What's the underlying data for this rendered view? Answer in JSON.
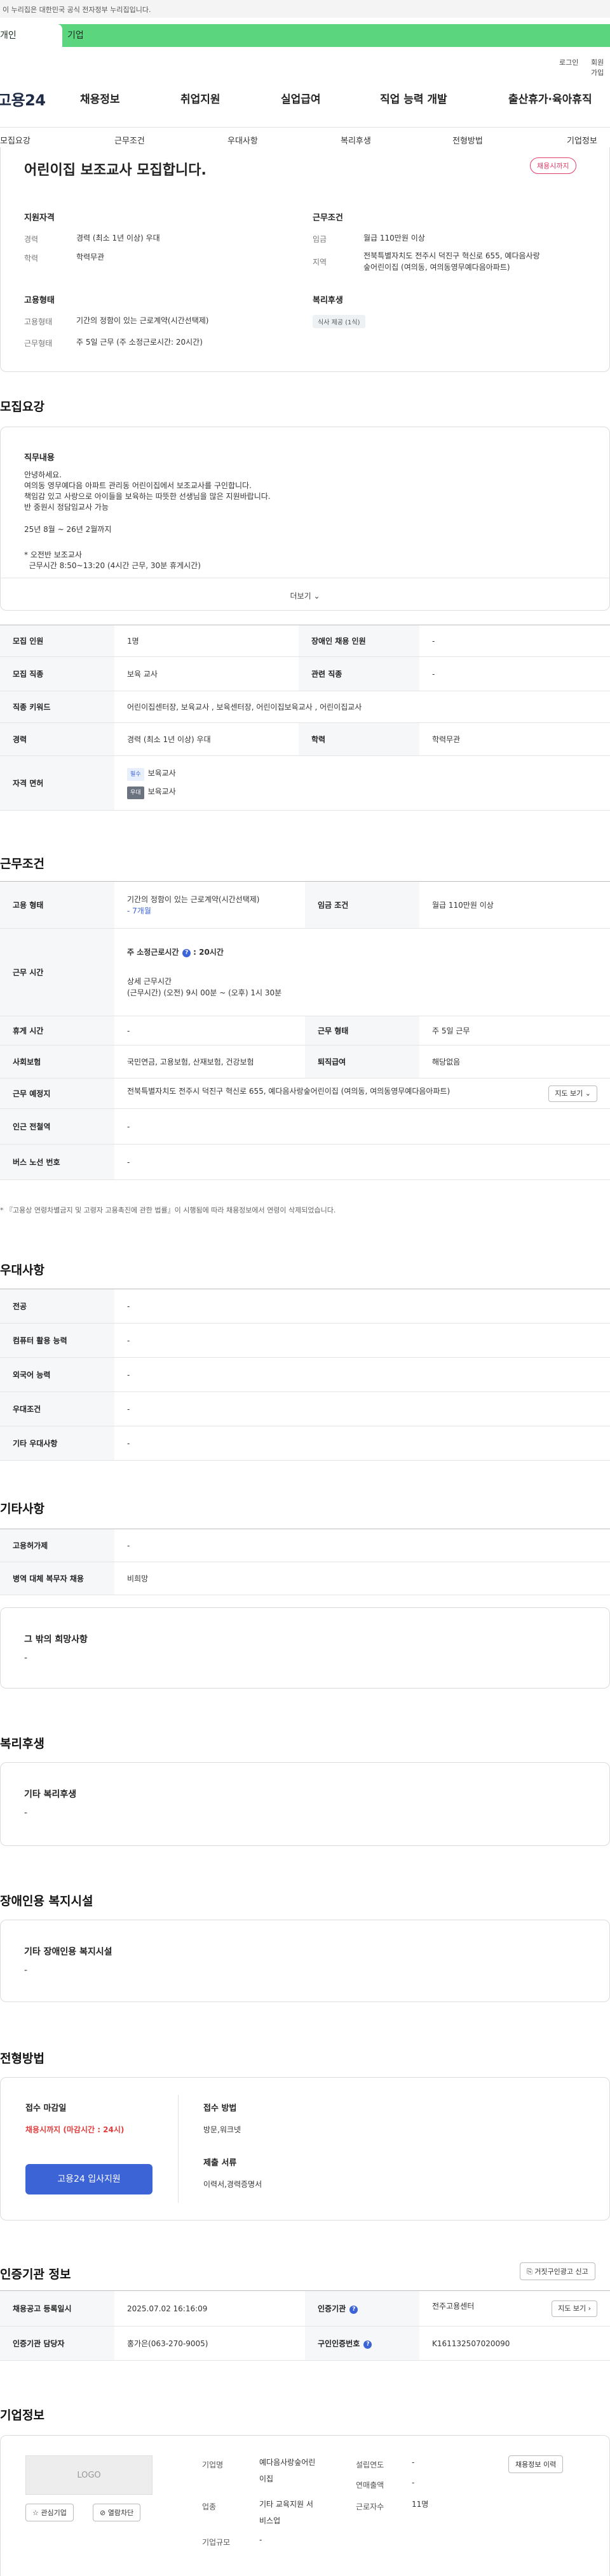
{
  "gov_banner": "이 누리집은 대한민국 공식 전자정부 누리집입니다.",
  "top_tabs": {
    "personal": "개인",
    "company": "기업"
  },
  "utility": {
    "login": "로그인",
    "signup": "회원가입"
  },
  "logo": "고용24",
  "gnb": [
    "채용정보",
    "취업지원",
    "실업급여",
    "직업 능력 개발",
    "출산휴가·육아휴직"
  ],
  "lnb": [
    "모집요강",
    "근무조건",
    "우대사항",
    "복리후생",
    "전형방법",
    "기업정보"
  ],
  "headline": {
    "title": "어린이집 보조교사 모집합니다.",
    "badge": "채용시까지"
  },
  "summary": {
    "qual_heading": "지원자격",
    "career_label": "경력",
    "career_value": "경력 (최소 1년 이상) 우대",
    "edu_label": "학력",
    "edu_value": "학력무관",
    "cond_heading": "근무조건",
    "wage_label": "임금",
    "wage_value": "월급 110만원 이상",
    "region_label": "지역",
    "region_value1": "전북특별자치도 전주시 덕진구 혁신로 655, 예다음사랑",
    "region_value2": "숲어린이집 (여의동, 여의동영무예다음아파트)",
    "emp_heading": "고용형태",
    "emptype_label": "고용형태",
    "emptype_value": "기간의 정함이 있는 근로계약(시간선택제)",
    "worktype_label": "근무형태",
    "worktype_value": "주 5일 근무 (주 소정근로시간: 20시간)",
    "welfare_heading": "복리후생",
    "welfare_tag": "식사 제공 (1식)"
  },
  "recruit": {
    "title": "모집요강",
    "job_heading": "직무내용",
    "lines": [
      "안녕하세요.",
      "여의동 영무예다음 아파트 관리동 어린이집에서 보조교사를 구인합니다.",
      "책임감 있고 사랑으로 아이들을 보육하는 따뜻한 선생님을 많은 지원바랍니다.",
      "반 중원시 정담임교사 가능",
      "",
      "25년 8월 ~ 26년 2월까지",
      "",
      "* 오전반 보조교사",
      "  근무시간 8:50~13:20 (4시간 근무, 30분 휴게시간)"
    ],
    "more_label": "더보기",
    "rows": {
      "headcount_label": "모집 인원",
      "headcount_value": "1명",
      "disabled_label": "장애인 채용 인원",
      "disabled_value": "-",
      "jobtype_label": "모집 직종",
      "jobtype_value": "보육 교사",
      "related_label": "관련 직종",
      "related_value": "-",
      "keyword_label": "직종 키워드",
      "keyword_value": "어린이집센터장, 보육교사 , 보육센터장, 어린이집보육교사 , 어린이집교사",
      "career_label": "경력",
      "career_value": "경력 (최소 1년 이상) 우대",
      "edu_label": "학력",
      "edu_value": "학력무관",
      "license_label": "자격 면허",
      "license_tag1": "필수",
      "license_value1": "보육교사",
      "license_tag2": "우대",
      "license_value2": "보육교사"
    }
  },
  "conditions": {
    "title": "근무조건",
    "emptype_label": "고용 형태",
    "emptype_value": "기간의 정함이 있는 근로계약(시간선택제)",
    "emptype_sub": "- 7개월",
    "wage_label": "임금 조건",
    "wage_value": "월급 110만원 이상",
    "hours_label": "근무 시간",
    "hours_main": "주 소정근로시간",
    "hours_main_value": ": 20시간",
    "hours_detail_title": "상세 근무시간",
    "hours_detail_value": "(근무시간) (오전) 9시 00분 ~ (오후) 1시 30분",
    "break_label": "휴게 시간",
    "break_value": "-",
    "form_label": "근무 형태",
    "form_value": "주 5일 근무",
    "insurance_label": "사회보험",
    "insurance_value": "국민연금, 고용보험, 산재보험, 건강보험",
    "severance_label": "퇴직급여",
    "severance_value": "해당없음",
    "place_label": "근무 예정지",
    "place_value": "전북특별자치도 전주시 덕진구 혁신로 655, 예다음사랑숲어린이집 (여의동, 여의동영무예다음아파트)",
    "map_btn": "지도 보기",
    "station_label": "인근 전철역",
    "station_value": "-",
    "bus_label": "버스 노선 번호",
    "bus_value": "-",
    "note": "* 『고용상 연령차별금지 및 고령자 고용촉진에 관한 법률』이 시행됨에 따라 채용정보에서 연령이 삭제되었습니다."
  },
  "preferences": {
    "title": "우대사항",
    "rows": [
      {
        "label": "전공",
        "value": "-"
      },
      {
        "label": "컴퓨터 활용 능력",
        "value": "-"
      },
      {
        "label": "외국어 능력",
        "value": "-"
      },
      {
        "label": "우대조건",
        "value": "-"
      },
      {
        "label": "기타 우대사항",
        "value": "-"
      }
    ]
  },
  "other": {
    "title": "기타사항",
    "rows": [
      {
        "label": "고용허가제",
        "value": "-"
      },
      {
        "label": "병역 대체 복무자 채용",
        "value": "비희망"
      }
    ],
    "extra_label": "그 밖의 희망사항",
    "extra_value": "-"
  },
  "welfare": {
    "title": "복리후생",
    "label": "기타 복리후생",
    "value": "-"
  },
  "disability": {
    "title": "장애인용 복지시설",
    "label": "기타 장애인용 복지시설",
    "value": "-"
  },
  "selection": {
    "title": "전형방법",
    "deadline_label": "접수 마감일",
    "deadline_value": "채용시까지 (마감시간 : 24시)",
    "method_label": "접수 방법",
    "method_value": "방문,워크넷",
    "docs_label": "제출 서류",
    "docs_value": "이력서,경력증명서",
    "apply_btn": "고용24 입사지원"
  },
  "agency": {
    "title": "인증기관 정보",
    "report_btn": "거짓구인광고 신고",
    "reg_label": "채용공고 등록일시",
    "reg_value": "2025.07.02 16:16:09",
    "org_label": "인증기관",
    "org_value": "전주고용센터",
    "map_btn": "지도 보기",
    "manager_label": "인증기관 담당자",
    "manager_value": "홍가은(063-270-9005)",
    "cert_label": "구인인증번호",
    "cert_value": "K161132507020090"
  },
  "company": {
    "title": "기업정보",
    "logo_text": "LOGO",
    "fav_btn": "관심기업",
    "block_btn": "열람차단",
    "name_label": "기업명",
    "name_value1": "예다음사랑숲어린",
    "name_value2": "이집",
    "industry_label": "업종",
    "industry_value1": "기타 교육지원 서",
    "industry_value2": "비스업",
    "size_label": "기업규모",
    "size_value": "-",
    "founded_label": "설립연도",
    "founded_value": "-",
    "revenue_label": "연매출액",
    "revenue_value": "-",
    "employees_label": "근로자수",
    "employees_value": "11명",
    "history_btn": "채용정보 이력"
  }
}
